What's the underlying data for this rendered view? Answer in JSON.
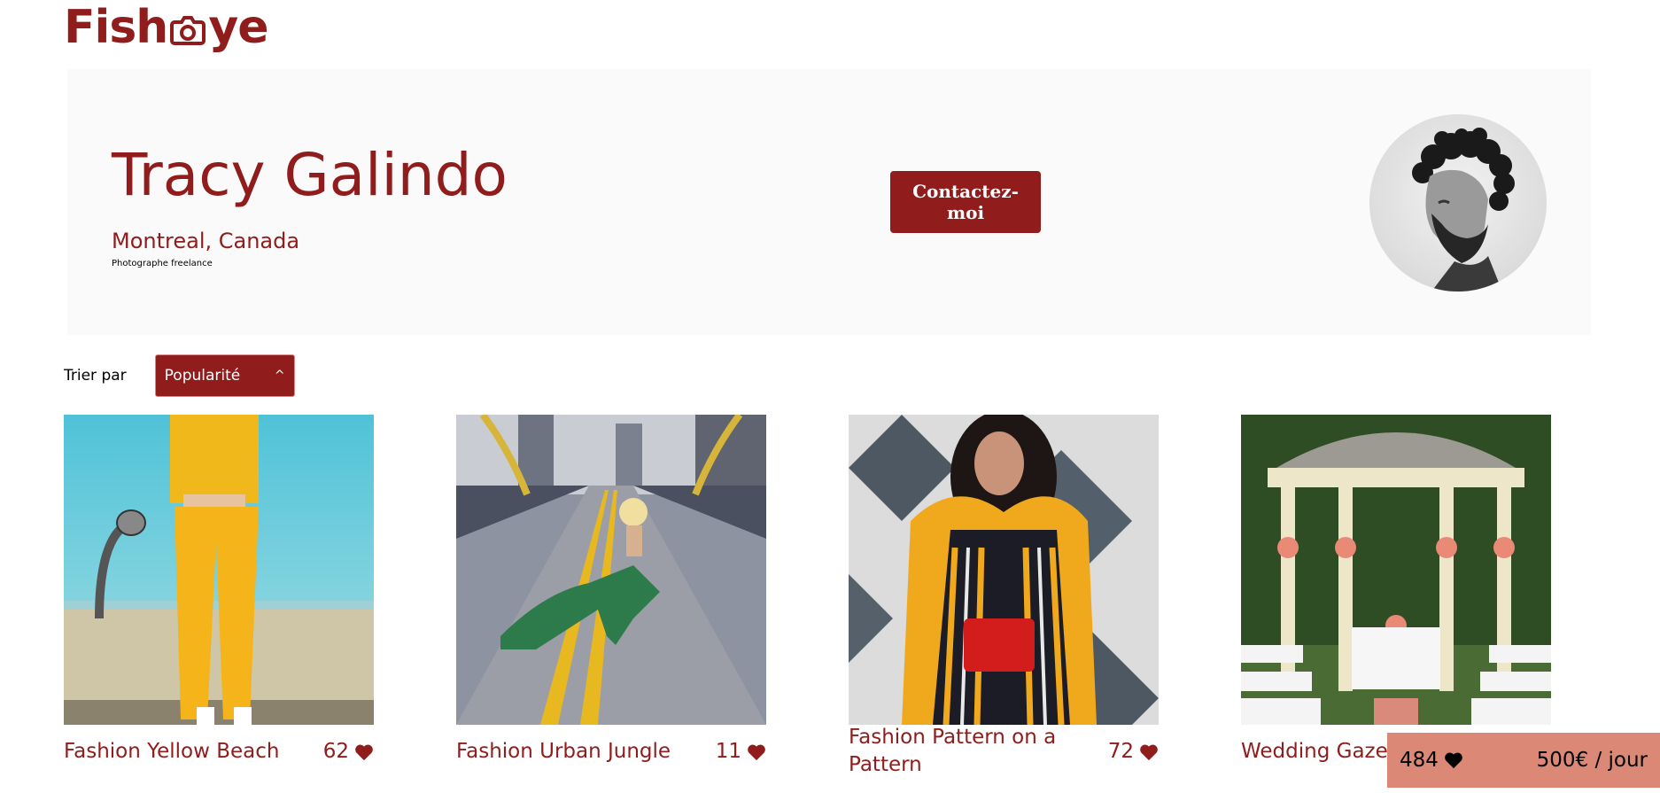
{
  "logo": {
    "text_before": "Fish",
    "text_after": "ye"
  },
  "photographer": {
    "name": "Tracy Galindo",
    "location": "Montreal, Canada",
    "tagline": "Photographe freelance"
  },
  "contact_button": {
    "label": "Contactez-moi"
  },
  "sort": {
    "label": "Trier par",
    "selected": "Popularité"
  },
  "gallery": [
    {
      "title": "Fashion Yellow Beach",
      "likes": "62"
    },
    {
      "title": "Fashion Urban Jungle",
      "likes": "11"
    },
    {
      "title": "Fashion Pattern on a Pattern",
      "likes": "72"
    },
    {
      "title": "Wedding Gazebo",
      "likes": ""
    }
  ],
  "footer": {
    "total_likes": "484",
    "price": "500€ / jour"
  },
  "colors": {
    "brand": "#901c1c",
    "header_bg": "#fafafa",
    "footer_bg": "#db8876"
  }
}
